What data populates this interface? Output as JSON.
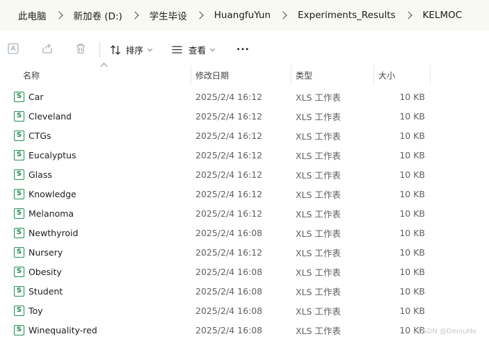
{
  "breadcrumb": {
    "items": [
      "此电脑",
      "新加卷 (D:)",
      "学生毕设",
      "HuangfuYun",
      "Experiments_Results",
      "KELMOC"
    ]
  },
  "toolbar": {
    "sort_label": "排序",
    "view_label": "查看",
    "more_label": "..."
  },
  "header": {
    "name": "名称",
    "date": "修改日期",
    "type": "类型",
    "size": "大小"
  },
  "files": [
    {
      "name": "Car",
      "date": "2025/2/4 16:12",
      "type": "XLS 工作表",
      "size": "10 KB"
    },
    {
      "name": "Cleveland",
      "date": "2025/2/4 16:12",
      "type": "XLS 工作表",
      "size": "10 KB"
    },
    {
      "name": "CTGs",
      "date": "2025/2/4 16:12",
      "type": "XLS 工作表",
      "size": "10 KB"
    },
    {
      "name": "Eucalyptus",
      "date": "2025/2/4 16:12",
      "type": "XLS 工作表",
      "size": "10 KB"
    },
    {
      "name": "Glass",
      "date": "2025/2/4 16:12",
      "type": "XLS 工作表",
      "size": "10 KB"
    },
    {
      "name": "Knowledge",
      "date": "2025/2/4 16:12",
      "type": "XLS 工作表",
      "size": "10 KB"
    },
    {
      "name": "Melanoma",
      "date": "2025/2/4 16:12",
      "type": "XLS 工作表",
      "size": "10 KB"
    },
    {
      "name": "Newthyroid",
      "date": "2025/2/4 16:08",
      "type": "XLS 工作表",
      "size": "10 KB"
    },
    {
      "name": "Nursery",
      "date": "2025/2/4 16:12",
      "type": "XLS 工作表",
      "size": "10 KB"
    },
    {
      "name": "Obesity",
      "date": "2025/2/4 16:08",
      "type": "XLS 工作表",
      "size": "10 KB"
    },
    {
      "name": "Student",
      "date": "2025/2/4 16:08",
      "type": "XLS 工作表",
      "size": "10 KB"
    },
    {
      "name": "Toy",
      "date": "2025/2/4 16:08",
      "type": "XLS 工作表",
      "size": "10 KB"
    },
    {
      "name": "Winequality-red",
      "date": "2025/2/4 16:08",
      "type": "XLS 工作表",
      "size": "10 KB"
    }
  ],
  "file_icon_letter": "S",
  "file_icon_color": "#1e8c4e",
  "watermark": "CSDN @DeniuHe"
}
